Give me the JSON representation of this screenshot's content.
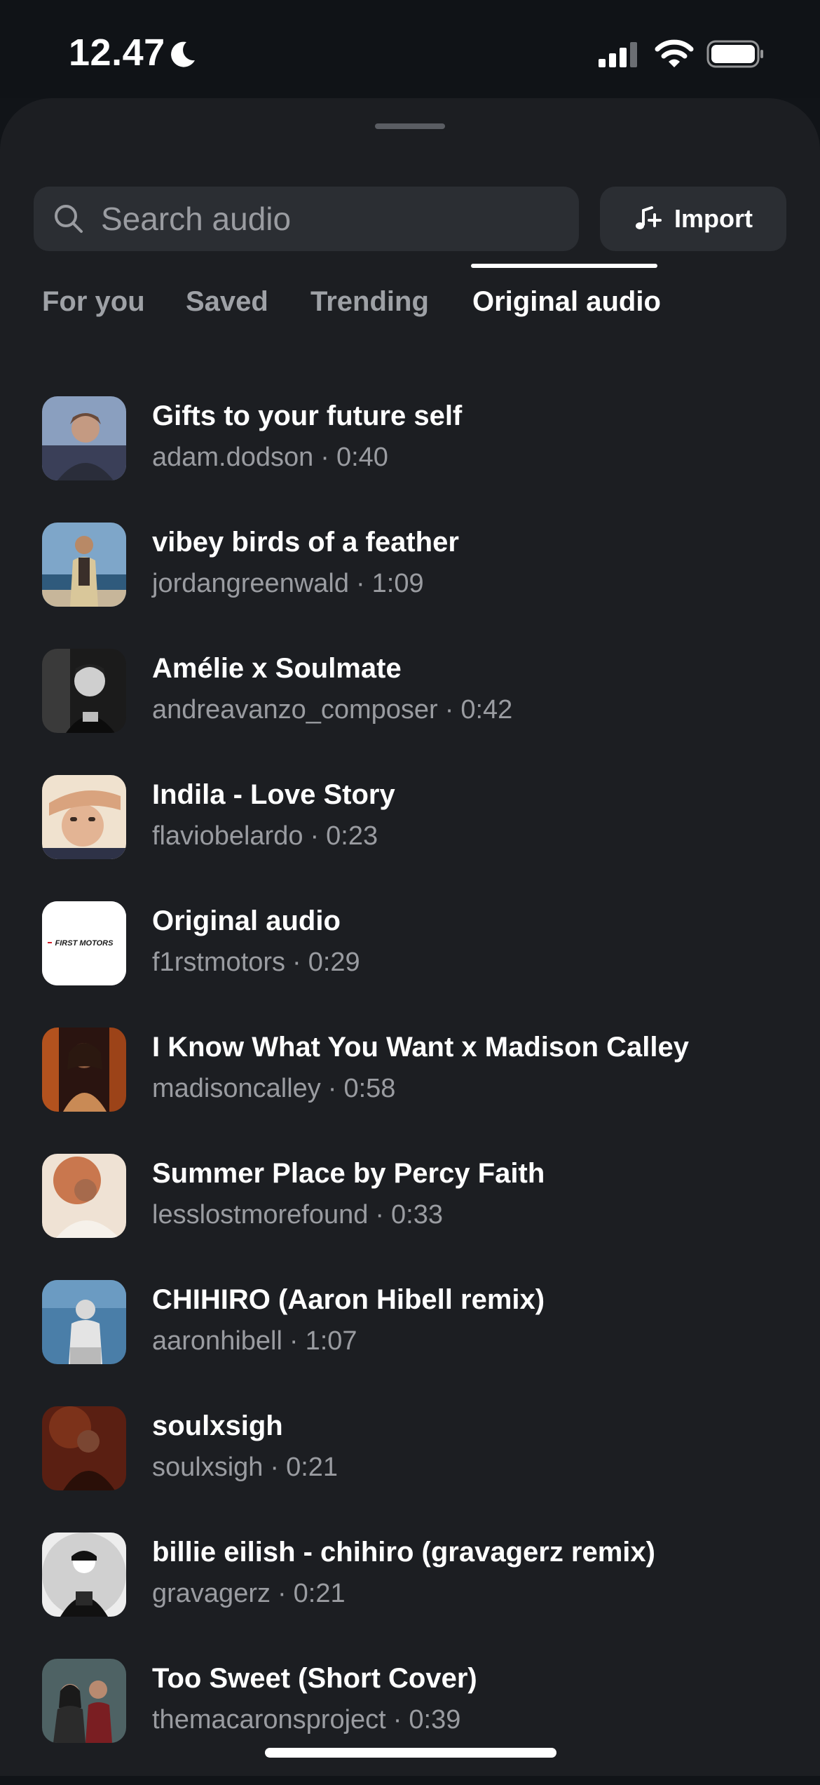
{
  "status_bar": {
    "time": "12.47",
    "icons": [
      "moon-icon",
      "signal-icon",
      "wifi-icon",
      "battery-icon"
    ]
  },
  "search": {
    "placeholder": "Search audio",
    "value": ""
  },
  "import_button": {
    "label": "Import",
    "icon": "music-note-plus-icon"
  },
  "tabs": [
    {
      "label": "For you",
      "active": false
    },
    {
      "label": "Saved",
      "active": false
    },
    {
      "label": "Trending",
      "active": false
    },
    {
      "label": "Original audio",
      "active": true
    }
  ],
  "audio_items": [
    {
      "title": "Gifts to your future self",
      "author": "adam.dodson",
      "duration": "0:40"
    },
    {
      "title": "vibey birds of a feather",
      "author": "jordangreenwald",
      "duration": "1:09"
    },
    {
      "title": "Amélie x Soulmate",
      "author": "andreavanzo_composer",
      "duration": "0:42"
    },
    {
      "title": "Indila - Love Story",
      "author": "flaviobelardo",
      "duration": "0:23"
    },
    {
      "title": "Original audio",
      "author": "f1rstmotors",
      "duration": "0:29",
      "thumb_text": "FIRST MOTORS"
    },
    {
      "title": "I Know What You Want x Madison Calley",
      "author": "madisoncalley",
      "duration": "0:58"
    },
    {
      "title": "Summer Place by Percy Faith",
      "author": "lesslostmorefound",
      "duration": "0:33"
    },
    {
      "title": "CHIHIRO (Aaron Hibell remix)",
      "author": "aaronhibell",
      "duration": "1:07"
    },
    {
      "title": "soulxsigh",
      "author": "soulxsigh",
      "duration": "0:21"
    },
    {
      "title": "billie eilish - chihiro (gravagerz remix)",
      "author": "gravagerz",
      "duration": "0:21"
    },
    {
      "title": "Too Sweet (Short Cover)",
      "author": "themacaronsproject",
      "duration": "0:39"
    }
  ],
  "colors": {
    "background": "#111418",
    "sheet": "#1c1e22",
    "field": "#2b2e33",
    "text_primary": "#ffffff",
    "text_secondary": "#9a9ca1"
  }
}
